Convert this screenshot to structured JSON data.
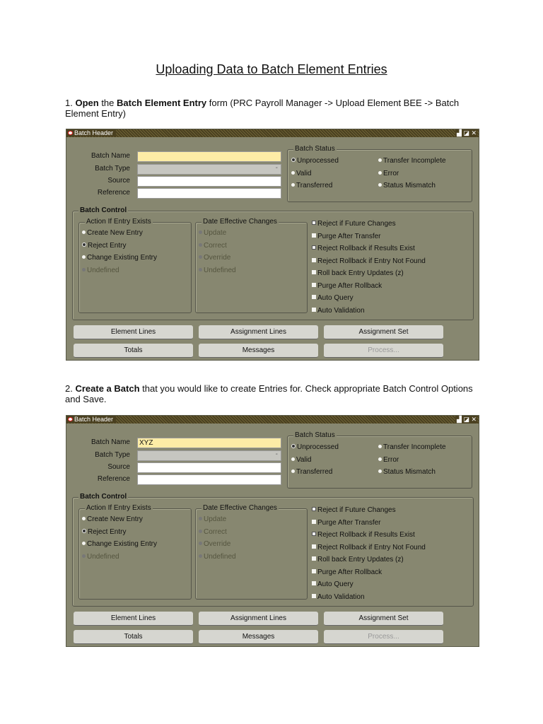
{
  "title": "Uploading Data to Batch Element Entries",
  "step1": {
    "num": "1.",
    "b1": "Open",
    "t1": " the ",
    "b2": "Batch Element Entry",
    "t2": " form (PRC Payroll Manager -> Upload Element BEE -> Batch Element Entry)"
  },
  "step2": {
    "num": "2.",
    "b1": "Create a Batch",
    "t1": " that you would like to create Entries for. Check appropriate Batch Control Options and Save."
  },
  "forms": [
    {
      "window_title": "Batch Header",
      "window_controls": "▟ ◪ ✕",
      "fields": [
        {
          "label": "Batch Name",
          "value": ""
        },
        {
          "label": "Batch Type",
          "value": ""
        },
        {
          "label": "Source",
          "value": ""
        },
        {
          "label": "Reference",
          "value": ""
        }
      ],
      "batch_status": {
        "title": "Batch Status",
        "options": [
          "Unprocessed",
          "Valid",
          "Transferred",
          "Transfer Incomplete",
          "Error",
          "Status Mismatch"
        ],
        "selected": "Unprocessed"
      },
      "batch_control": {
        "title": "Batch Control",
        "action": {
          "title": "Action If Entry Exists",
          "options": [
            "Create New Entry",
            "Reject Entry",
            "Change Existing Entry",
            "Undefined"
          ],
          "selected": "Reject Entry"
        },
        "date": {
          "title": "Date Effective Changes",
          "options": [
            "Update",
            "Correct",
            "Override",
            "Undefined"
          ]
        },
        "checks": [
          {
            "label": "Reject if Future Changes",
            "checked": true
          },
          {
            "label": "Purge After Transfer",
            "checked": false
          },
          {
            "label": "Reject Rollback if Results Exist",
            "checked": true
          },
          {
            "label": "Reject Rollback if Entry Not Found",
            "checked": false
          },
          {
            "label": "Roll back Entry Updates (z)",
            "checked": false
          },
          {
            "label": "Purge After Rollback",
            "checked": false
          },
          {
            "label": "Auto Query",
            "checked": false
          },
          {
            "label": "Auto Validation",
            "checked": false
          }
        ]
      },
      "buttons": [
        "Element Lines",
        "Assignment Lines",
        "Assignment Set",
        "Totals",
        "Messages",
        "Process..."
      ]
    },
    {
      "window_title": "Batch Header",
      "window_controls": "▟ ◪ ✕",
      "fields": [
        {
          "label": "Batch Name",
          "value": "XYZ"
        },
        {
          "label": "Batch Type",
          "value": ""
        },
        {
          "label": "Source",
          "value": ""
        },
        {
          "label": "Reference",
          "value": ""
        }
      ],
      "batch_status": {
        "title": "Batch Status",
        "options": [
          "Unprocessed",
          "Valid",
          "Transferred",
          "Transfer Incomplete",
          "Error",
          "Status Mismatch"
        ],
        "selected": "Unprocessed"
      },
      "batch_control": {
        "title": "Batch Control",
        "action": {
          "title": "Action If Entry Exists",
          "options": [
            "Create New Entry",
            "Reject Entry",
            "Change Existing Entry",
            "Undefined"
          ],
          "selected": "Reject Entry"
        },
        "date": {
          "title": "Date Effective Changes",
          "options": [
            "Update",
            "Correct",
            "Override",
            "Undefined"
          ]
        },
        "checks": [
          {
            "label": "Reject if Future Changes",
            "checked": true
          },
          {
            "label": "Purge After Transfer",
            "checked": false
          },
          {
            "label": "Reject Rollback if Results Exist",
            "checked": true
          },
          {
            "label": "Reject Rollback if Entry Not Found",
            "checked": false
          },
          {
            "label": "Roll back Entry Updates (z)",
            "checked": false
          },
          {
            "label": "Purge After Rollback",
            "checked": false
          },
          {
            "label": "Auto Query",
            "checked": false
          },
          {
            "label": "Auto Validation",
            "checked": false
          }
        ]
      },
      "buttons": [
        "Element Lines",
        "Assignment Lines",
        "Assignment Set",
        "Totals",
        "Messages",
        "Process..."
      ]
    }
  ]
}
